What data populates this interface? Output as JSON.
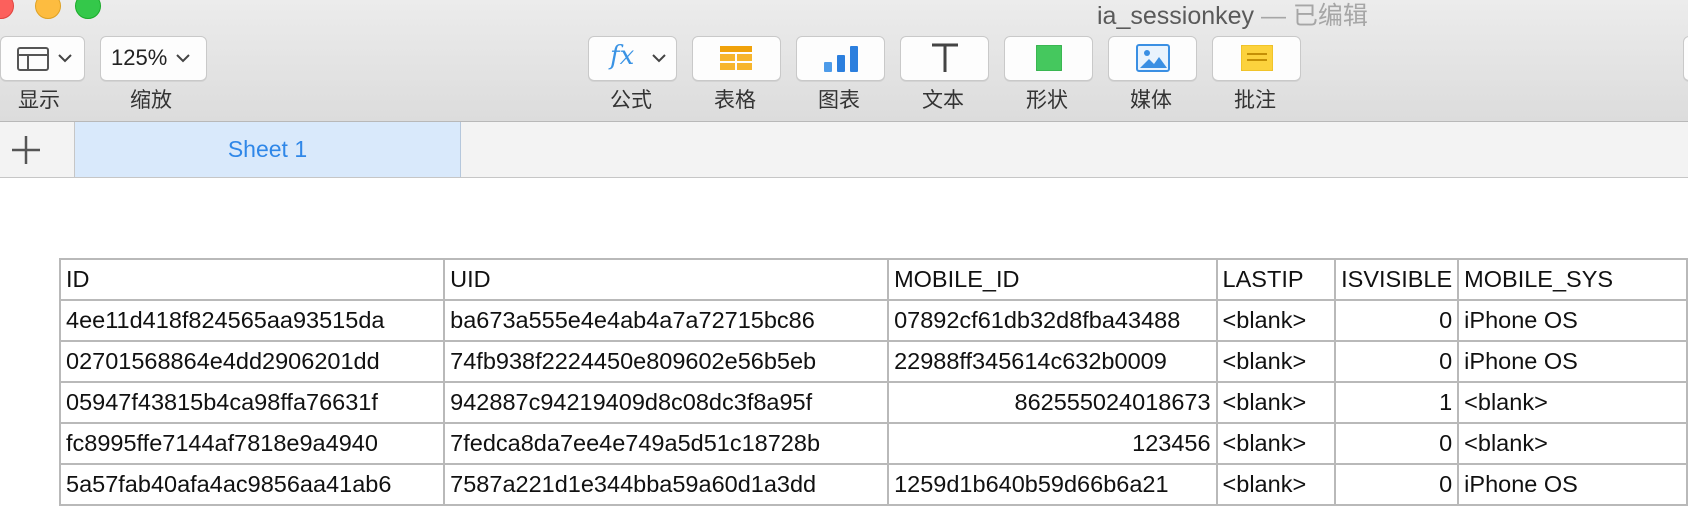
{
  "window": {
    "title": "ia_sessionkey",
    "edited": "— 已编辑"
  },
  "toolbar": {
    "view_label": "显示",
    "zoom_value": "125%",
    "zoom_label": "缩放",
    "formula_label": "公式",
    "table_label": "表格",
    "chart_label": "图表",
    "text_label": "文本",
    "shape_label": "形状",
    "media_label": "媒体",
    "comment_label": "批注"
  },
  "sheets": {
    "add_icon": "plus-icon",
    "tabs": [
      {
        "label": "Sheet 1"
      }
    ]
  },
  "table": {
    "columns": [
      "ID",
      "UID",
      "MOBILE_ID",
      "LASTIP",
      "ISVISIBLE",
      "MOBILE_SYS"
    ],
    "rows": [
      [
        "4ee11d418f824565aa93515da",
        "ba673a555e4e4ab4a7a72715bc86",
        "07892cf61db32d8fba43488",
        "<blank>",
        "0",
        "iPhone OS"
      ],
      [
        "02701568864e4dd2906201dd",
        "74fb938f2224450e809602e56b5eb",
        "22988ff345614c632b0009",
        "<blank>",
        "0",
        "iPhone OS"
      ],
      [
        "05947f43815b4ca98ffa76631f",
        "942887c94219409d8c08dc3f8a95f",
        "862555024018673",
        "<blank>",
        "1",
        "<blank>"
      ],
      [
        "fc8995ffe7144af7818e9a4940",
        "7fedca8da7ee4e749a5d51c18728b",
        "123456",
        "<blank>",
        "0",
        "<blank>"
      ],
      [
        "5a57fab40afa4ac9856aa41ab6",
        "7587a221d1e344bba59a60d1a3dd",
        "1259d1b640b59d66b6a21",
        "<blank>",
        "0",
        "iPhone OS"
      ]
    ]
  },
  "colors": {
    "accent": "#2f87e8",
    "selected_tab_bg": "#d9e9fb",
    "grid_line": "#b9b9b9"
  }
}
